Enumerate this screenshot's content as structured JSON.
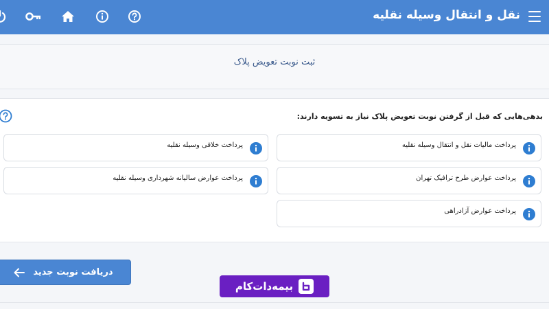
{
  "header": {
    "title": "نقل و انتقال وسیله نقلیه",
    "icons": [
      "menu-icon",
      "help-circle-icon",
      "info-circle-icon",
      "home-icon",
      "key-icon",
      "power-icon"
    ],
    "background": "#4a86d3"
  },
  "page": {
    "title": "ثبت نوبت تعویض پلاک"
  },
  "debts": {
    "heading": "بدهی‌هایی که قبل از گرفتن نوبت تعویض پلاک نیاز به تسویه دارند:",
    "items": [
      {
        "label": "پرداخت مالیات نقل و انتقال وسیله نقلیه"
      },
      {
        "label": "پرداخت عوارض طرح ترافیک تهران"
      },
      {
        "label": "پرداخت عوارض آزادراهی"
      },
      {
        "label": "پرداخت خلافی وسیله نقلیه"
      },
      {
        "label": "پرداخت عوارض سالیانه شهرداری وسیله نقلیه"
      }
    ],
    "info_color": "#2e7dd1"
  },
  "actions": {
    "new_turn_label": "دریافت نوبت جدید"
  },
  "watermark": {
    "text": "بیمه‌دات‌کام"
  }
}
